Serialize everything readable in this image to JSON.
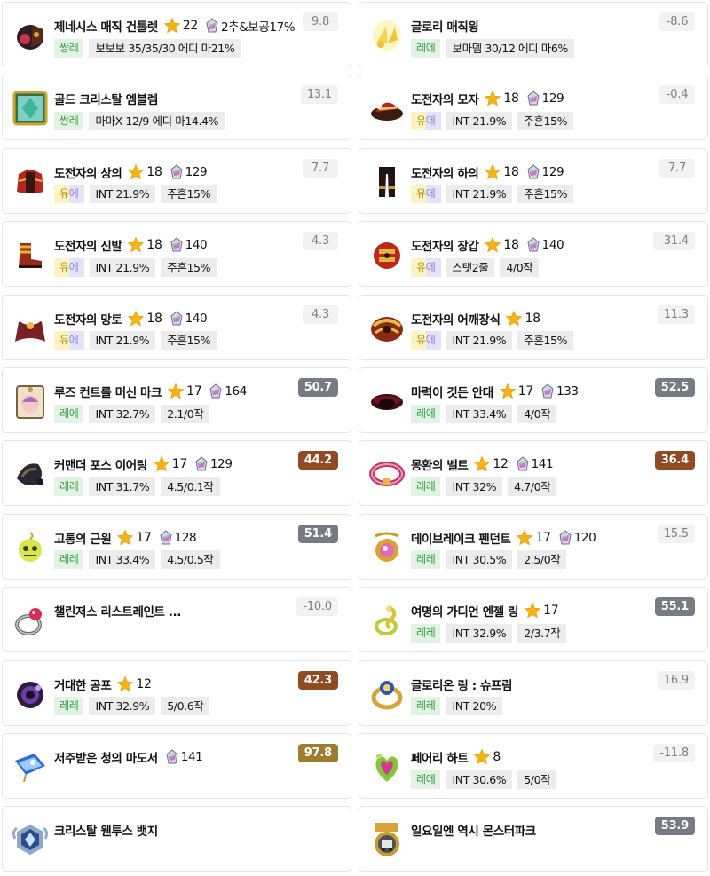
{
  "colors": {
    "legendary_text": "#2f9a3f",
    "unique_text": "#b7930a",
    "score_gray": "#777b84",
    "score_brown": "#8e4b24",
    "score_gold": "#9d7e2e",
    "star": "#f5b416"
  },
  "items": [
    {
      "name": "제네시스 매직 건틀렛",
      "icon": "genesis-gauntlet-icon",
      "star": "22",
      "gem": "2추&보공17%",
      "grade": "쌍레",
      "chips": [
        "보보보 35/35/30 에디 마21%"
      ],
      "score": "9.8",
      "score_style": "plain"
    },
    {
      "name": "글로리 매직윙",
      "icon": "glory-wing-icon",
      "grade": "레에",
      "chips": [
        "보마뎀 30/12 에디 마6%"
      ],
      "score": "-8.6",
      "score_style": "plain"
    },
    {
      "name": "골드 크리스탈 엠블렘",
      "icon": "gold-crystal-emblem-icon",
      "grade": "쌍레",
      "chips": [
        "마마X 12/9 에디 마14.4%"
      ],
      "score": "13.1",
      "score_style": "plain"
    },
    {
      "name": "도전자의 모자",
      "icon": "challenger-hat-icon",
      "star": "18",
      "gem": "129",
      "grade": "유에",
      "chips": [
        "INT 21.9%",
        "주흔15%"
      ],
      "score": "-0.4",
      "score_style": "plain"
    },
    {
      "name": "도전자의 상의",
      "icon": "challenger-top-icon",
      "star": "18",
      "gem": "129",
      "grade": "유에",
      "chips": [
        "INT 21.9%",
        "주흔15%"
      ],
      "score": "7.7",
      "score_style": "plain"
    },
    {
      "name": "도전자의 하의",
      "icon": "challenger-bottom-icon",
      "star": "18",
      "gem": "129",
      "grade": "유에",
      "chips": [
        "INT 21.9%",
        "주흔15%"
      ],
      "score": "7.7",
      "score_style": "plain"
    },
    {
      "name": "도전자의 신발",
      "icon": "challenger-shoes-icon",
      "star": "18",
      "gem": "140",
      "grade": "유에",
      "chips": [
        "INT 21.9%",
        "주흔15%"
      ],
      "score": "4.3",
      "score_style": "plain"
    },
    {
      "name": "도전자의 장갑",
      "icon": "challenger-gloves-icon",
      "star": "18",
      "gem": "140",
      "grade": "유에",
      "chips": [
        "스탯2줄",
        "4/0작"
      ],
      "score": "-31.4",
      "score_style": "plain"
    },
    {
      "name": "도전자의 망토",
      "icon": "challenger-cape-icon",
      "star": "18",
      "gem": "140",
      "grade": "유에",
      "chips": [
        "INT 21.9%",
        "주흔15%"
      ],
      "score": "4.3",
      "score_style": "plain"
    },
    {
      "name": "도전자의 어깨장식",
      "icon": "challenger-shoulder-icon",
      "star": "18",
      "grade": "유에",
      "chips": [
        "INT 21.9%",
        "주흔15%"
      ],
      "score": "11.3",
      "score_style": "plain"
    },
    {
      "name": "루즈 컨트롤 머신 마크",
      "icon": "loose-control-machine-mark-icon",
      "star": "17",
      "gem": "164",
      "grade": "레에",
      "chips": [
        "INT 32.7%",
        "2.1/0작"
      ],
      "score": "50.7",
      "score_style": "gray"
    },
    {
      "name": "마력이 깃든 안대",
      "icon": "magic-eyepatch-icon",
      "star": "17",
      "gem": "133",
      "grade": "레에",
      "chips": [
        "INT 33.4%",
        "4/0작"
      ],
      "score": "52.5",
      "score_style": "gray"
    },
    {
      "name": "커맨더 포스 이어링",
      "icon": "commander-force-earring-icon",
      "star": "17",
      "gem": "129",
      "grade": "레레",
      "chips": [
        "INT 31.7%",
        "4.5/0.1작"
      ],
      "score": "44.2",
      "score_style": "brown"
    },
    {
      "name": "몽환의 벨트",
      "icon": "dreamy-belt-icon",
      "star": "12",
      "gem": "141",
      "grade": "레레",
      "chips": [
        "INT 32%",
        "4.7/0작"
      ],
      "score": "36.4",
      "score_style": "brown"
    },
    {
      "name": "고통의 근원",
      "icon": "source-of-suffering-icon",
      "star": "17",
      "gem": "128",
      "grade": "레레",
      "chips": [
        "INT 33.4%",
        "4.5/0.5작"
      ],
      "score": "51.4",
      "score_style": "gray"
    },
    {
      "name": "데이브레이크 펜던트",
      "icon": "daybreak-pendant-icon",
      "star": "17",
      "gem": "120",
      "grade": "레레",
      "chips": [
        "INT 30.5%",
        "2.5/0작"
      ],
      "score": "15.5",
      "score_style": "plain"
    },
    {
      "name": "챌린저스 리스트레인트 ...",
      "icon": "challengers-restraint-ring-icon",
      "score": "-10.0",
      "score_style": "plain"
    },
    {
      "name": "여명의 가디언 엔젤 링",
      "icon": "dawn-guardian-angel-ring-icon",
      "star": "17",
      "grade": "레레",
      "chips": [
        "INT 32.9%",
        "2/3.7작"
      ],
      "score": "55.1",
      "score_style": "gray"
    },
    {
      "name": "거대한 공포",
      "icon": "magnificent-fear-icon",
      "star": "12",
      "grade": "레레",
      "chips": [
        "INT 32.9%",
        "5/0.6작"
      ],
      "score": "42.3",
      "score_style": "brown"
    },
    {
      "name": "글로리온 링 : 슈프림",
      "icon": "glorion-ring-supreme-icon",
      "grade": "레레",
      "chips": [
        "INT 20%"
      ],
      "score": "16.9",
      "score_style": "plain"
    },
    {
      "name": "저주받은 청의 마도서",
      "icon": "cursed-blue-grimoire-icon",
      "gem": "141",
      "score": "97.8",
      "score_style": "gold"
    },
    {
      "name": "페어리 하트",
      "icon": "fairy-heart-icon",
      "star": "8",
      "grade": "레에",
      "chips": [
        "INT 30.6%",
        "5/0작"
      ],
      "score": "-11.8",
      "score_style": "plain"
    },
    {
      "name": "크리스탈 웬투스 뱃지",
      "icon": "crystal-ventus-badge-icon"
    },
    {
      "name": "일요일엔 역시 몬스터파크",
      "icon": "monster-park-medal-icon",
      "score": "53.9",
      "score_style": "gray"
    }
  ]
}
